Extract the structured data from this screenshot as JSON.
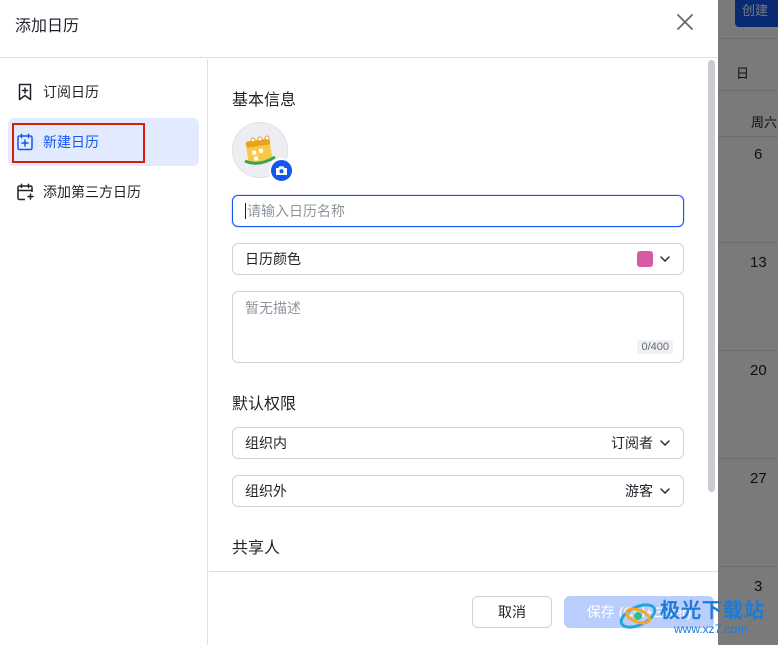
{
  "dialog": {
    "title": "添加日历"
  },
  "sidebar": {
    "items": [
      {
        "label": "订阅日历",
        "icon": "bookmark-plus-icon",
        "active": false
      },
      {
        "label": "新建日历",
        "icon": "calendar-plus-icon",
        "active": true
      },
      {
        "label": "添加第三方日历",
        "icon": "calendar-link-icon",
        "active": false
      }
    ]
  },
  "basic": {
    "title": "基本信息",
    "name_placeholder": "请输入日历名称",
    "color_label": "日历颜色",
    "color_value": "#d85aa6",
    "desc_placeholder": "暂无描述",
    "desc_counter": "0/400"
  },
  "permissions": {
    "title": "默认权限",
    "inside_label": "组织内",
    "inside_value": "订阅者",
    "outside_label": "组织外",
    "outside_value": "游客"
  },
  "share": {
    "title": "共享人"
  },
  "footer": {
    "cancel_label": "取消",
    "save_label": "保存 (Ctrl+Enter)"
  },
  "background": {
    "create_label": "创建",
    "header_day": "日",
    "weekday": "周六",
    "dates": [
      "6",
      "13",
      "20",
      "27",
      "3"
    ]
  },
  "watermark": {
    "text": "极光下载站",
    "url": "www.xz7.com"
  },
  "colors": {
    "accent": "#1456f0",
    "active_bg": "#e1eaff",
    "highlight_border": "#d81e06"
  }
}
